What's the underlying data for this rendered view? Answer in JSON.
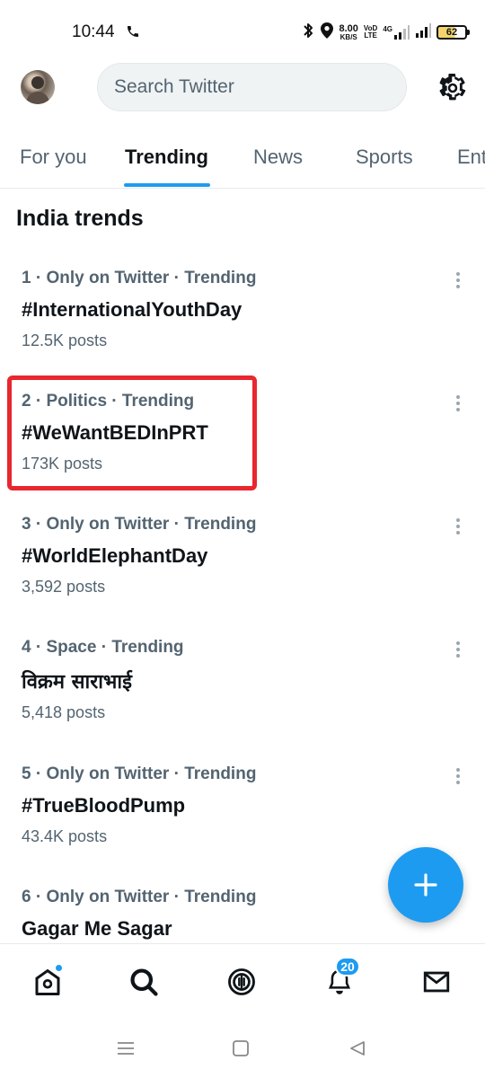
{
  "status_bar": {
    "time": "10:44",
    "net_speed_value": "8.00",
    "net_speed_unit": "KB/S",
    "volte_top": "VoD",
    "volte_bottom": "LTE",
    "network_type": "4G",
    "battery": "62"
  },
  "header": {
    "search_placeholder": "Search Twitter"
  },
  "tabs": [
    {
      "label": "For you",
      "active": false
    },
    {
      "label": "Trending",
      "active": true
    },
    {
      "label": "News",
      "active": false
    },
    {
      "label": "Sports",
      "active": false
    },
    {
      "label": "Ent",
      "active": false
    }
  ],
  "section_title": "India trends",
  "trends": [
    {
      "meta": "1 · Only on Twitter · Trending",
      "name": "#InternationalYouthDay",
      "count": "12.5K posts"
    },
    {
      "meta": "2 · Politics · Trending",
      "name": "#WeWantBEDInPRT",
      "count": "173K posts"
    },
    {
      "meta": "3 · Only on Twitter · Trending",
      "name": "#WorldElephantDay",
      "count": "3,592 posts"
    },
    {
      "meta": "4 · Space · Trending",
      "name": "विक्रम साराभाई",
      "count": "5,418 posts"
    },
    {
      "meta": "5 · Only on Twitter · Trending",
      "name": "#TrueBloodPump",
      "count": "43.4K posts"
    },
    {
      "meta": "6 · Only on Twitter · Trending",
      "name": "Gagar Me Sagar",
      "count": ""
    }
  ],
  "bottom_nav": {
    "notifications_badge": "20"
  },
  "colors": {
    "accent": "#1d9bf0",
    "highlight": "#e8272e",
    "secondary_text": "#536471"
  }
}
